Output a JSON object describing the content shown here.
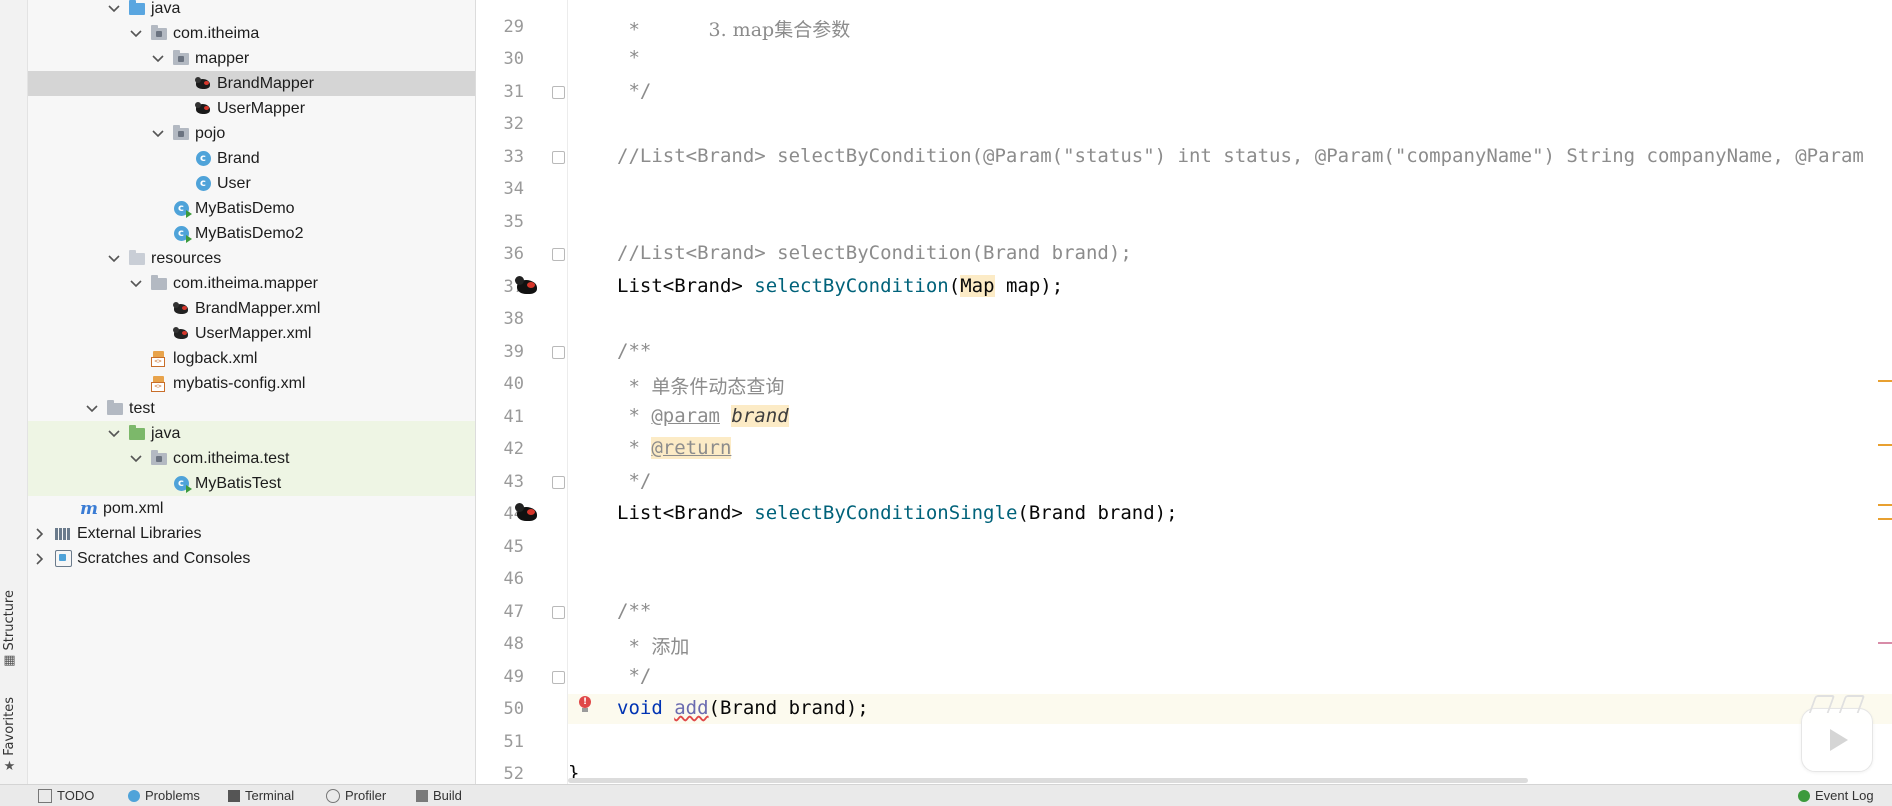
{
  "side_tabs": {
    "structure": "Structure",
    "favorites": "Favorites"
  },
  "project_tree": [
    {
      "label": "java",
      "icon": "folder-icon"
    },
    {
      "label": "com.itheima",
      "icon": "package-icon"
    },
    {
      "label": "mapper",
      "icon": "package-icon"
    },
    {
      "label": "BrandMapper",
      "icon": "mybatis-icon"
    },
    {
      "label": "UserMapper",
      "icon": "mybatis-icon"
    },
    {
      "label": "pojo",
      "icon": "package-icon"
    },
    {
      "label": "Brand",
      "icon": "class-icon"
    },
    {
      "label": "User",
      "icon": "class-icon"
    },
    {
      "label": "MyBatisDemo",
      "icon": "runnable-class-icon"
    },
    {
      "label": "MyBatisDemo2",
      "icon": "runnable-class-icon"
    },
    {
      "label": "resources",
      "icon": "resources-folder-icon"
    },
    {
      "label": "com.itheima.mapper",
      "icon": "folder-icon"
    },
    {
      "label": "BrandMapper.xml",
      "icon": "mybatis-xml-icon"
    },
    {
      "label": "UserMapper.xml",
      "icon": "mybatis-xml-icon"
    },
    {
      "label": "logback.xml",
      "icon": "xml-file-icon"
    },
    {
      "label": "mybatis-config.xml",
      "icon": "xml-file-icon"
    },
    {
      "label": "test",
      "icon": "folder-icon"
    },
    {
      "label": "java",
      "icon": "test-folder-icon"
    },
    {
      "label": "com.itheima.test",
      "icon": "package-icon"
    },
    {
      "label": "MyBatisTest",
      "icon": "runnable-class-icon"
    },
    {
      "label": "pom.xml",
      "icon": "maven-icon"
    },
    {
      "label": "External Libraries",
      "icon": "libraries-icon"
    },
    {
      "label": "Scratches and Consoles",
      "icon": "scratches-icon"
    }
  ],
  "editor": {
    "line_numbers": [
      "29",
      "30",
      "31",
      "32",
      "33",
      "34",
      "35",
      "36",
      "37",
      "38",
      "39",
      "40",
      "41",
      "42",
      "43",
      "44",
      "45",
      "46",
      "47",
      "48",
      "49",
      "50",
      "51",
      "52"
    ],
    "code": {
      "l29_star": " *      ",
      "l29_text": "3. map集合参数",
      "l30": " *",
      "l31": " */",
      "l33_a": "//List<Brand> selectByCondition(@Param(\"status\") int status, @Param(\"companyName\") String companyName, @Param",
      "l36": "//List<Brand> selectByCondition(Brand brand);",
      "l37_a": "List<Brand> ",
      "l37_fn": "selectByCondition",
      "l37_b": "(",
      "l37_map": "Map",
      "l37_c": " map);",
      "l39": "/**",
      "l40_star": " * ",
      "l40_text": "单条件动态查询",
      "l41_star": " * ",
      "l41_tag": "@param",
      "l41_sp": " ",
      "l41_name": "brand",
      "l42_star": " * ",
      "l42_tag": "@return",
      "l43": " */",
      "l44_a": "List<Brand> ",
      "l44_fn": "selectByConditionSingle",
      "l44_b": "(Brand brand);",
      "l47": "/**",
      "l48_star": " * ",
      "l48_text": "添加",
      "l49": " */",
      "l50_kw": "void",
      "l50_sp": " ",
      "l50_fn": "add",
      "l50_b": "(Brand brand);",
      "l52": "}"
    }
  },
  "statusbar": {
    "todo": "TODO",
    "problems": "Problems",
    "terminal": "Terminal",
    "profiler": "Profiler",
    "build": "Build",
    "event_log": "Event Log"
  },
  "colors": {
    "selection": "#d5d5d5",
    "test_bg": "#eef5e4",
    "comment": "#8c8c8c",
    "function": "#00627a",
    "keyword": "#0033b3",
    "highlight": "#fcebc6"
  }
}
